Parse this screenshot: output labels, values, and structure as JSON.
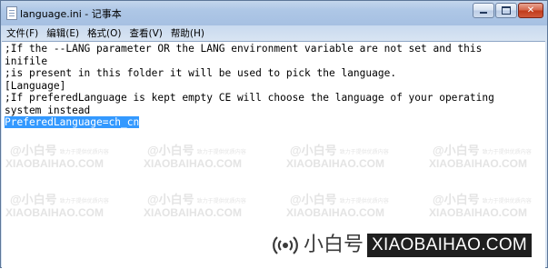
{
  "window": {
    "title": "language.ini - 记事本",
    "controls": {
      "minimize": "minimize",
      "maximize": "maximize",
      "close": "✕"
    }
  },
  "menu": [
    "文件(F)",
    "编辑(E)",
    "格式(O)",
    "查看(V)",
    "帮助(H)"
  ],
  "document": {
    "lines": [
      ";If the --LANG parameter OR the LANG environment variable are not set and this",
      "inifile",
      ";is present in this folder it will be used to pick the language.",
      "[Language]",
      ";If preferedLanguage is kept empty CE will choose the language of your operating",
      "system instead",
      "PreferedLanguage=ch_cn"
    ],
    "selected_line_index": 6
  },
  "watermark": {
    "cn": "@小白号",
    "cn_sub": "致力于提供优质内容",
    "en": "XIAOBAIHAO.COM"
  },
  "logo": {
    "cn": "小白号",
    "en": "XIAOBAIHAO.COM"
  },
  "colors": {
    "selection": "#3399ff",
    "title_gradient_top": "#c4d6ec"
  }
}
